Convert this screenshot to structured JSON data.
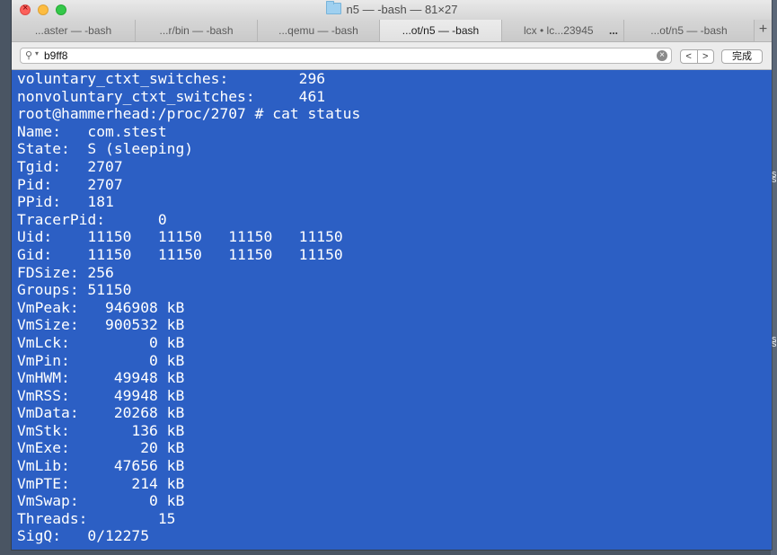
{
  "window": {
    "title": "n5 — -bash — 81×27"
  },
  "tabs": [
    {
      "label": "...aster — -bash",
      "active": false
    },
    {
      "label": "...r/bin — -bash",
      "active": false
    },
    {
      "label": "...qemu — -bash",
      "active": false
    },
    {
      "label": "...ot/n5 — -bash",
      "active": true
    },
    {
      "label": "lcx • lc...23945",
      "active": false,
      "more": "..."
    },
    {
      "label": "...ot/n5 — -bash",
      "active": false
    }
  ],
  "new_tab_label": "+",
  "find_bar": {
    "search_value": "b9ff8",
    "prev_label": "<",
    "next_label": ">",
    "done_label": "完成"
  },
  "terminal": {
    "background": "#2c5fc4",
    "foreground": "#ffffff",
    "lines": [
      "voluntary_ctxt_switches:        296",
      "nonvoluntary_ctxt_switches:     461",
      "root@hammerhead:/proc/2707 # cat status",
      "Name:   com.stest",
      "State:  S (sleeping)",
      "Tgid:   2707",
      "Pid:    2707",
      "PPid:   181",
      "TracerPid:      0",
      "Uid:    11150   11150   11150   11150",
      "Gid:    11150   11150   11150   11150",
      "FDSize: 256",
      "Groups: 51150",
      "VmPeak:   946908 kB",
      "VmSize:   900532 kB",
      "VmLck:         0 kB",
      "VmPin:         0 kB",
      "VmHWM:     49948 kB",
      "VmRSS:     49948 kB",
      "VmData:    20268 kB",
      "VmStk:       136 kB",
      "VmExe:        20 kB",
      "VmLib:     47656 kB",
      "VmPTE:       214 kB",
      "VmSwap:        0 kB",
      "Threads:        15",
      "SigQ:   0/12275"
    ]
  },
  "background_peek": [
    "s",
    "s",
    "s",
    "s"
  ]
}
